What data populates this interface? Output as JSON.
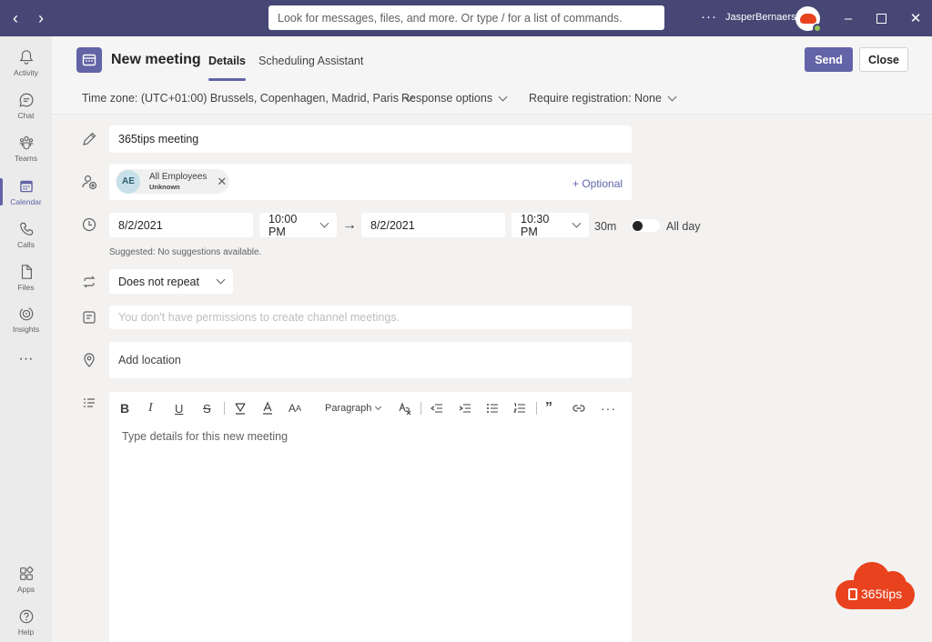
{
  "titlebar": {
    "search_placeholder": "Look for messages, files, and more. Or type / for a list of commands.",
    "more": "···",
    "user_name": "JasperBernaers"
  },
  "rail": [
    {
      "label": "Activity",
      "icon": "bell-icon"
    },
    {
      "label": "Chat",
      "icon": "chat-icon"
    },
    {
      "label": "Teams",
      "icon": "teams-icon"
    },
    {
      "label": "Calendar",
      "icon": "calendar-icon",
      "active": true
    },
    {
      "label": "Calls",
      "icon": "phone-icon"
    },
    {
      "label": "Files",
      "icon": "file-icon"
    },
    {
      "label": "Insights",
      "icon": "insights-icon"
    },
    {
      "label": "···",
      "icon": "more-icon"
    },
    {
      "label": "Apps",
      "icon": "apps-icon"
    },
    {
      "label": "Help",
      "icon": "help-icon"
    }
  ],
  "header": {
    "title": "New meeting",
    "tabs": [
      {
        "label": "Details",
        "active": true
      },
      {
        "label": "Scheduling Assistant",
        "active": false
      }
    ],
    "send_label": "Send",
    "close_label": "Close",
    "timezone": "Time zone: (UTC+01:00) Brussels, Copenhagen, Madrid, Paris",
    "response_options": "Response options",
    "registration": "Require registration: None"
  },
  "form": {
    "title_value": "365tips meeting",
    "attendee": {
      "initials": "AE",
      "name": "All Employees",
      "status": "Unknown"
    },
    "optional_label": "+ Optional",
    "start_date": "8/2/2021",
    "start_time": "10:00 PM",
    "end_date": "8/2/2021",
    "end_time": "10:30 PM",
    "duration": "30m",
    "all_day_label": "All day",
    "all_day": false,
    "suggestion": "Suggested: No suggestions available.",
    "repeat": "Does not repeat",
    "channel_placeholder": "You don't have permissions to create channel meetings.",
    "location_placeholder": "Add location",
    "editor": {
      "paragraph_label": "Paragraph",
      "placeholder": "Type details for this new meeting"
    }
  },
  "brand": {
    "text": "365tips"
  },
  "colors": {
    "accent": "#6264a7",
    "titlebar": "#464775",
    "brand": "#e8431e"
  }
}
